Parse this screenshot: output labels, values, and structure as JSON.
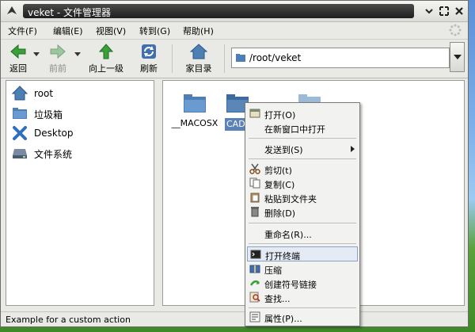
{
  "window": {
    "title": "veket - 文件管理器"
  },
  "menubar": {
    "items": [
      "文件(F)",
      "编辑(E)",
      "视图(V)",
      "转到(G)",
      "帮助(H)"
    ]
  },
  "toolbar": {
    "back": "返回",
    "forward": "前前",
    "up": "向上一级",
    "refresh": "刷新",
    "home": "家目录"
  },
  "address": {
    "path": "/root/veket"
  },
  "sidebar": {
    "items": [
      {
        "label": "root",
        "icon": "home-icon"
      },
      {
        "label": "垃圾箱",
        "icon": "trash-folder-icon"
      },
      {
        "label": "Desktop",
        "icon": "desktop-icon"
      },
      {
        "label": "文件系统",
        "icon": "drive-icon"
      }
    ]
  },
  "main": {
    "folders": [
      {
        "name": "__MACOSX"
      },
      {
        "name": "CAD 5b18"
      },
      {
        "name": ""
      }
    ]
  },
  "context_menu": {
    "items": [
      {
        "label": "打开(O)",
        "icon": "open-icon"
      },
      {
        "label": "在新窗口中打开"
      },
      {
        "label": "发送到(S)"
      },
      {
        "label": "剪切(t)",
        "icon": "scissors-icon"
      },
      {
        "label": "复制(C)",
        "icon": "copy-icon"
      },
      {
        "label": "粘贴到文件夹",
        "icon": "paste-icon"
      },
      {
        "label": "删除(D)",
        "icon": "trash-icon"
      },
      {
        "label": "重命名(R)..."
      },
      {
        "label": "打开终端",
        "icon": "terminal-icon"
      },
      {
        "label": "压缩",
        "icon": "archive-icon"
      },
      {
        "label": "创建符号链接",
        "icon": "link-icon"
      },
      {
        "label": "查找...",
        "icon": "find-icon"
      },
      {
        "label": "属性(P)...",
        "icon": "properties-icon"
      }
    ]
  },
  "statusbar": {
    "text": "Example for a custom action"
  },
  "colors": {
    "selection": "#5a82b8",
    "titlebar": "#2a2a2a",
    "accent_green": "#3aa13a",
    "folder": "#4d7fb5"
  }
}
